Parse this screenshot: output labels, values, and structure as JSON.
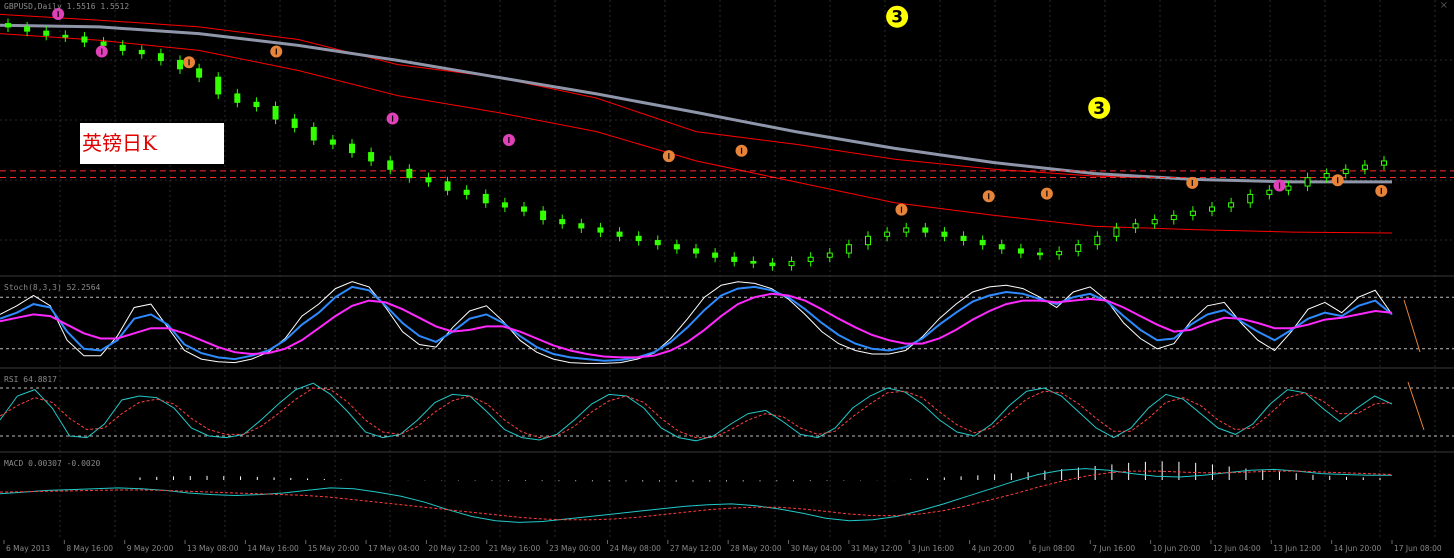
{
  "symbol_header": "GBPUSD,Daily  1.5516 1.5512",
  "panel_headers": [
    "Stoch(8,3,3) 52.2564",
    "RSI 64.8817",
    "MACD 0.00307 -0.0020"
  ],
  "chart_label": "英镑日K",
  "close_glyph": "×",
  "colors": {
    "background": "#000000",
    "bull_candle": "#33ff00",
    "bear_candle": "#ffffff",
    "envelope": "#ff0000",
    "ma_long": "#8f96aa",
    "marker_orange": "#e8843a",
    "marker_pink": "#e040b8",
    "marker_yellow": "#ffff00",
    "level_line": "#ff2a2a",
    "stoch_white": "#ffffff",
    "stoch_blue": "#2e8bff",
    "stoch_magenta": "#ff28ff",
    "osc_cyan": "#22c8c8",
    "osc_red": "#ff4040",
    "hist_white": "#ffffff",
    "signal_dash": "#ff3c3c"
  },
  "chart_data": [
    {
      "type": "line",
      "title": "",
      "x_labels": [
        "6 May 2013",
        "8 May 16:00",
        "9 May 20:00",
        "13 May 08:00",
        "14 May 16:00",
        "15 May 20:00",
        "17 May 04:00",
        "20 May 12:00",
        "21 May 16:00",
        "23 May 00:00",
        "24 May 08:00",
        "27 May 12:00",
        "28 May 20:00",
        "30 May 04:00",
        "31 May 12:00",
        "3 Jun 16:00",
        "4 Jun 20:00",
        "6 Jun 08:00",
        "7 Jun 16:00",
        "10 Jun 20:00",
        "12 Jun 04:00",
        "13 Jun 12:00",
        "14 Jun 20:00",
        "17 Jun 08:00"
      ],
      "series": [
        {
          "role": "candles_close",
          "values": [
            1.553,
            1.5525,
            1.552,
            1.5518,
            1.5512,
            1.5508,
            1.5502,
            1.5498,
            1.549,
            1.548,
            1.547,
            1.545,
            1.544,
            1.5435,
            1.542,
            1.541,
            1.5395,
            1.539,
            1.538,
            1.537,
            1.536,
            1.535,
            1.5345,
            1.5335,
            1.533,
            1.532,
            1.5315,
            1.531,
            1.53,
            1.5295,
            1.529,
            1.5285,
            1.528,
            1.5275,
            1.527,
            1.5265,
            1.526,
            1.5255,
            1.525,
            1.5248,
            1.5245,
            1.525,
            1.5255,
            1.526,
            1.527,
            1.528,
            1.5285,
            1.529,
            1.5285,
            1.528,
            1.5275,
            1.527,
            1.5265,
            1.526,
            1.5258,
            1.5262,
            1.527,
            1.528,
            1.529,
            1.5295,
            1.53,
            1.5305,
            1.531,
            1.5315,
            1.532,
            1.533,
            1.5335,
            1.534,
            1.535,
            1.5355,
            1.536,
            1.5365,
            1.537
          ]
        },
        {
          "role": "ma_long",
          "values": [
            1.5532,
            1.553,
            1.5522,
            1.5508,
            1.549,
            1.547,
            1.545,
            1.5428,
            1.5405,
            1.5385,
            1.5368,
            1.5355,
            1.5348,
            1.5345,
            1.5345
          ]
        },
        {
          "role": "envelope_upper",
          "values": [
            1.5545,
            1.5538,
            1.553,
            1.5515,
            1.5485,
            1.547,
            1.5445,
            1.5405,
            1.539,
            1.5372,
            1.536,
            1.5352,
            1.5348,
            1.5345,
            1.5344
          ]
        },
        {
          "role": "envelope_lower",
          "values": [
            1.5522,
            1.5514,
            1.5502,
            1.5478,
            1.5448,
            1.5428,
            1.5405,
            1.537,
            1.5345,
            1.532,
            1.5305,
            1.5292,
            1.5288,
            1.5285,
            1.5284
          ]
        }
      ],
      "fractal_markers": [
        {
          "x": 0.04,
          "y": 0.97,
          "kind": "pink"
        },
        {
          "x": 0.07,
          "y": 0.83,
          "kind": "pink"
        },
        {
          "x": 0.13,
          "y": 0.79,
          "kind": "orange"
        },
        {
          "x": 0.19,
          "y": 0.83,
          "kind": "orange"
        },
        {
          "x": 0.27,
          "y": 0.58,
          "kind": "pink"
        },
        {
          "x": 0.35,
          "y": 0.5,
          "kind": "pink"
        },
        {
          "x": 0.46,
          "y": 0.44,
          "kind": "orange"
        },
        {
          "x": 0.51,
          "y": 0.46,
          "kind": "orange"
        },
        {
          "x": 0.62,
          "y": 0.24,
          "kind": "orange"
        },
        {
          "x": 0.68,
          "y": 0.29,
          "kind": "orange"
        },
        {
          "x": 0.72,
          "y": 0.3,
          "kind": "orange"
        },
        {
          "x": 0.82,
          "y": 0.34,
          "kind": "orange"
        },
        {
          "x": 0.88,
          "y": 0.33,
          "kind": "pink"
        },
        {
          "x": 0.92,
          "y": 0.35,
          "kind": "orange"
        },
        {
          "x": 0.95,
          "y": 0.31,
          "kind": "orange"
        }
      ],
      "wave_labels": [
        {
          "x": 0.617,
          "y": 0.04,
          "text": "3"
        },
        {
          "x": 0.756,
          "y": 0.38,
          "text": "3"
        }
      ],
      "dashed_levels": [
        0.385,
        0.36
      ],
      "xlabel": "",
      "ylabel": "",
      "grid": true
    },
    {
      "type": "line",
      "title": "",
      "ylim": [
        0,
        100
      ],
      "series": [
        {
          "role": "stoch_main",
          "values": [
            55,
            62,
            72,
            68,
            40,
            20,
            18,
            30,
            55,
            60,
            48,
            25,
            15,
            10,
            8,
            12,
            18,
            30,
            48,
            62,
            80,
            92,
            88,
            70,
            50,
            35,
            28,
            40,
            55,
            60,
            50,
            35,
            22,
            14,
            10,
            8,
            6,
            7,
            10,
            16,
            28,
            45,
            65,
            82,
            90,
            92,
            88,
            80,
            66,
            50,
            36,
            26,
            20,
            18,
            22,
            32,
            48,
            62,
            75,
            82,
            86,
            84,
            78,
            72,
            80,
            84,
            75,
            58,
            42,
            30,
            32,
            48,
            60,
            65,
            52,
            40,
            30,
            42,
            55,
            62,
            58,
            70,
            76,
            60
          ]
        },
        {
          "role": "stoch_signal",
          "values": [
            52,
            56,
            60,
            58,
            48,
            38,
            32,
            32,
            38,
            44,
            44,
            38,
            30,
            22,
            16,
            14,
            15,
            20,
            30,
            44,
            58,
            70,
            76,
            74,
            66,
            56,
            46,
            40,
            42,
            46,
            46,
            40,
            32,
            24,
            18,
            14,
            11,
            10,
            10,
            12,
            18,
            28,
            42,
            58,
            72,
            80,
            84,
            82,
            76,
            66,
            55,
            45,
            36,
            30,
            26,
            26,
            32,
            42,
            54,
            64,
            72,
            76,
            76,
            74,
            76,
            78,
            76,
            68,
            58,
            48,
            40,
            42,
            50,
            56,
            55,
            50,
            44,
            44,
            48,
            54,
            56,
            60,
            64,
            62
          ]
        },
        {
          "role": "stoch_fast",
          "values": [
            60,
            70,
            82,
            70,
            30,
            12,
            12,
            35,
            68,
            72,
            45,
            18,
            8,
            5,
            4,
            8,
            16,
            32,
            58,
            72,
            90,
            98,
            92,
            68,
            40,
            25,
            22,
            45,
            64,
            70,
            52,
            30,
            16,
            8,
            4,
            3,
            3,
            4,
            8,
            15,
            32,
            55,
            80,
            94,
            98,
            96,
            90,
            78,
            60,
            40,
            26,
            18,
            14,
            14,
            18,
            34,
            55,
            72,
            86,
            92,
            94,
            90,
            80,
            68,
            86,
            92,
            76,
            50,
            32,
            20,
            26,
            52,
            70,
            74,
            50,
            30,
            18,
            40,
            66,
            74,
            62,
            80,
            88,
            60
          ]
        }
      ],
      "levels": [
        80,
        20
      ],
      "xlabel": "",
      "ylabel": ""
    },
    {
      "type": "line",
      "title": "",
      "ylim": [
        0,
        100
      ],
      "series": [
        {
          "role": "rsi_main",
          "values": [
            40,
            70,
            78,
            55,
            20,
            18,
            35,
            65,
            70,
            68,
            55,
            30,
            20,
            18,
            22,
            40,
            60,
            78,
            86,
            72,
            50,
            25,
            18,
            22,
            40,
            62,
            72,
            70,
            50,
            28,
            18,
            15,
            22,
            40,
            60,
            72,
            70,
            55,
            30,
            18,
            14,
            20,
            35,
            48,
            52,
            38,
            22,
            18,
            30,
            55,
            70,
            80,
            75,
            60,
            40,
            25,
            20,
            35,
            58,
            76,
            80,
            70,
            50,
            30,
            18,
            30,
            55,
            72,
            66,
            48,
            30,
            22,
            35,
            60,
            78,
            74,
            55,
            38,
            55,
            70,
            60
          ]
        },
        {
          "role": "rsi_signal",
          "values": [
            45,
            58,
            68,
            62,
            42,
            28,
            30,
            48,
            62,
            66,
            60,
            42,
            28,
            22,
            22,
            32,
            48,
            66,
            80,
            78,
            62,
            40,
            25,
            22,
            32,
            50,
            64,
            70,
            60,
            40,
            25,
            18,
            20,
            32,
            50,
            64,
            70,
            62,
            42,
            26,
            18,
            18,
            28,
            40,
            48,
            44,
            30,
            22,
            26,
            44,
            60,
            74,
            76,
            68,
            50,
            34,
            24,
            30,
            48,
            66,
            76,
            74,
            60,
            42,
            26,
            26,
            42,
            62,
            68,
            58,
            40,
            28,
            30,
            48,
            68,
            74,
            64,
            48,
            48,
            60,
            62
          ]
        }
      ],
      "levels": [
        80,
        20
      ],
      "xlabel": "",
      "ylabel": ""
    },
    {
      "type": "bar",
      "title": "",
      "ylim": [
        -100,
        100
      ],
      "histogram": [
        10,
        12,
        14,
        15,
        16,
        15,
        14,
        12,
        10,
        8,
        6,
        4,
        2,
        0,
        -2,
        -4,
        -6,
        -8,
        -10,
        -12,
        -14,
        -16,
        -18,
        -20,
        -22,
        -24,
        -26,
        -28,
        -30,
        -32,
        -34,
        -36,
        -38,
        -38,
        -36,
        -34,
        -32,
        -30,
        -28,
        -26,
        -22,
        -18,
        -14,
        -10,
        -6,
        -2,
        2,
        6,
        10,
        14,
        18,
        22,
        26,
        30,
        36,
        42,
        48,
        54,
        60,
        66,
        70,
        72,
        70,
        66,
        60,
        52,
        44,
        38,
        32,
        26,
        20,
        16,
        12,
        10,
        8
      ],
      "series": [
        {
          "role": "macd_main",
          "values": [
            10,
            14,
            18,
            20,
            22,
            24,
            22,
            18,
            12,
            8,
            6,
            8,
            12,
            18,
            24,
            22,
            14,
            4,
            -10,
            -28,
            -44,
            -54,
            -58,
            -56,
            -50,
            -44,
            -38,
            -32,
            -26,
            -20,
            -16,
            -14,
            -18,
            -26,
            -36,
            -48,
            -54,
            -52,
            -44,
            -30,
            -14,
            4,
            22,
            40,
            56,
            66,
            70,
            66,
            58,
            52,
            50,
            54,
            60,
            66,
            68,
            64,
            58,
            56,
            54,
            54
          ]
        },
        {
          "role": "macd_signal",
          "values": [
            14,
            15,
            16,
            17,
            18,
            19,
            19,
            18,
            16,
            14,
            12,
            10,
            8,
            6,
            2,
            -4,
            -10,
            -16,
            -22,
            -28,
            -34,
            -40,
            -46,
            -50,
            -52,
            -52,
            -50,
            -46,
            -40,
            -34,
            -28,
            -24,
            -22,
            -22,
            -26,
            -32,
            -38,
            -42,
            -42,
            -38,
            -30,
            -18,
            -4,
            10,
            26,
            40,
            52,
            60,
            64,
            64,
            62,
            60,
            60,
            62,
            64,
            64,
            62,
            60,
            58,
            56
          ]
        }
      ],
      "xlabel": "",
      "ylabel": ""
    }
  ]
}
